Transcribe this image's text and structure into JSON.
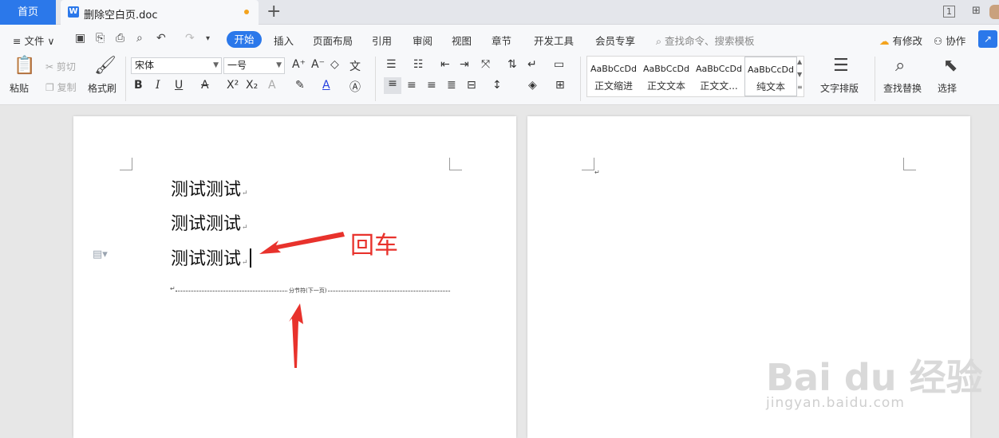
{
  "tabbar": {
    "home_label": "首页",
    "doc_icon": "W",
    "doc_title": "删除空白页.doc",
    "new_tab": "+",
    "page_indicator": "1"
  },
  "menubar": {
    "file_label": "≡ 文件 ∨",
    "tabs": [
      "开始",
      "插入",
      "页面布局",
      "引用",
      "审阅",
      "视图",
      "章节",
      "开发工具",
      "会员专享"
    ],
    "search_placeholder": "查找命令、搜索模板",
    "has_changes": "有修改",
    "collaborate": "协作"
  },
  "ribbon": {
    "paste": "粘贴",
    "cut": "剪切",
    "copy": "复制",
    "format_painter": "格式刷",
    "font_name": "宋体",
    "font_size": "一号",
    "styles": [
      {
        "sample": "AaBbCcDd",
        "name": "正文缩进"
      },
      {
        "sample": "AaBbCcDd",
        "name": "正文文本"
      },
      {
        "sample": "AaBbCcDd",
        "name": "正文文..."
      },
      {
        "sample": "AaBbCcDd",
        "name": "纯文本"
      }
    ],
    "text_layout": "文字排版",
    "find_replace": "查找替换",
    "select": "选择"
  },
  "document": {
    "lines": [
      "测试测试",
      "测试测试",
      "测试测试"
    ],
    "para_mark": "↵",
    "section_break": "分节符(下一页)"
  },
  "annotation": {
    "enter_label": "回车"
  },
  "watermark": {
    "logo": "Bai du 经验",
    "url": "jingyan.baidu.com"
  },
  "colors": {
    "accent": "#2b78ea",
    "annotation": "#e8322c"
  }
}
